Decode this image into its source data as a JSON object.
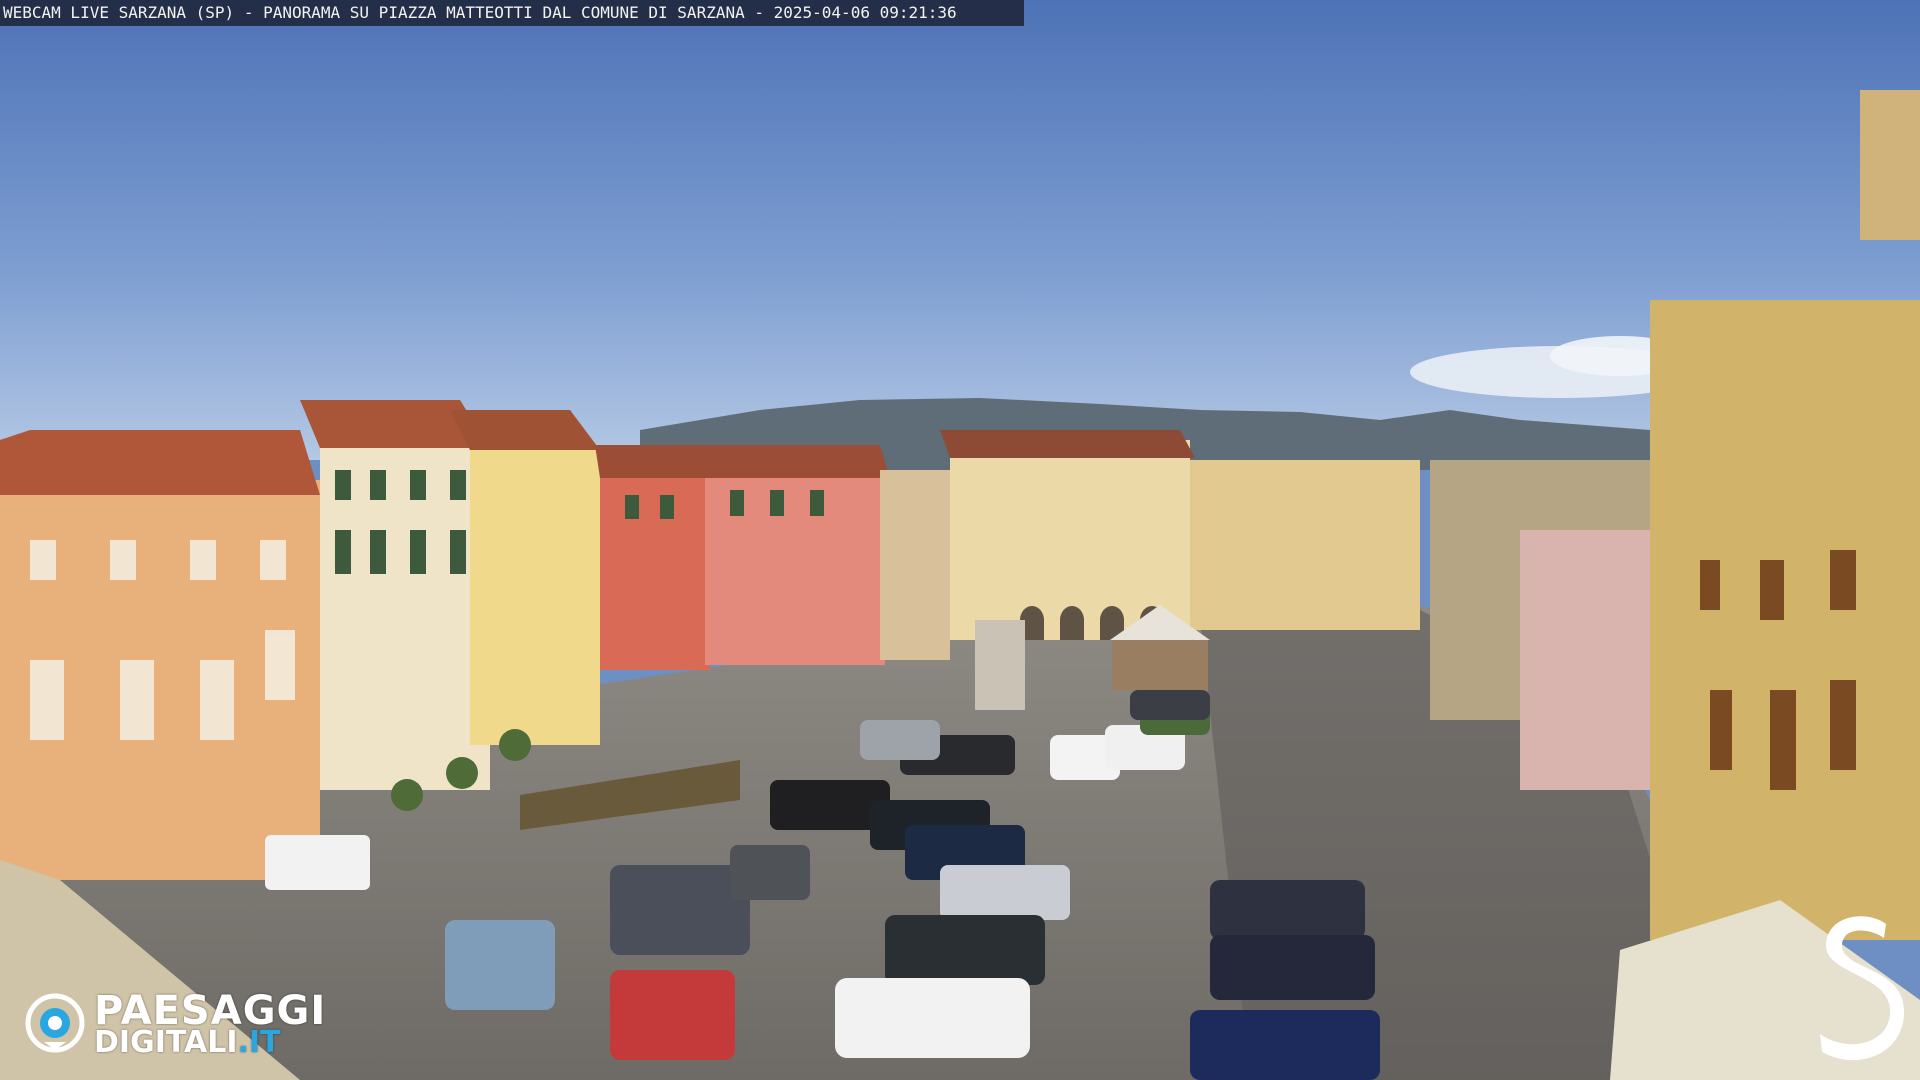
{
  "caption": "WEBCAM LIVE SARZANA (SP) - PANORAMA SU PIAZZA MATTEOTTI DAL COMUNE DI SARZANA - 2025-04-06  09:21:36",
  "logo": {
    "line1": "PAESAGGI",
    "line2_main": "DIGITALI",
    "line2_tld": ".IT",
    "icon": "eye-icon"
  },
  "brand_mark": {
    "icon": "s-letter-logo-icon"
  },
  "colors": {
    "sky_top": "#4f74b8",
    "sky_bottom": "#a9c2e6",
    "piazza": "#8a8783",
    "accent_logo_blue": "#2aa7e0"
  }
}
